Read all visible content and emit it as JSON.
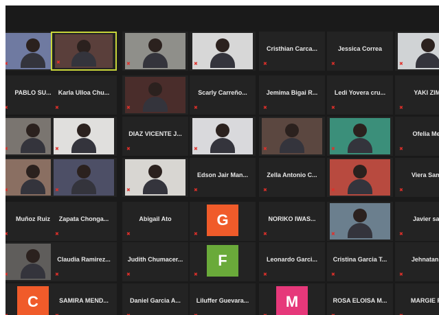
{
  "window": {
    "title": "Zoom gallery view"
  },
  "colors": {
    "speaking_border": "#c9d63a",
    "muted": "#e0302a",
    "grid_bg": "#1a1a1a"
  },
  "participants": [
    {
      "row": 0,
      "col": 0,
      "name": "",
      "type": "video",
      "bg": "#6f7aa1",
      "label": ""
    },
    {
      "row": 0,
      "col": 1,
      "name": "",
      "type": "video",
      "bg": "#5a3f3b",
      "label": "",
      "speaking": true
    },
    {
      "row": 0,
      "col": 2,
      "name": "",
      "type": "video",
      "bg": "#8f8f8a",
      "label": ""
    },
    {
      "row": 0,
      "col": 3,
      "name": "",
      "type": "video",
      "bg": "#d7d7d7",
      "label": ""
    },
    {
      "row": 0,
      "col": 4,
      "name": "Cristhian Carca...",
      "type": "name"
    },
    {
      "row": 0,
      "col": 5,
      "name": "Jessica Correa",
      "type": "name"
    },
    {
      "row": 0,
      "col": 6,
      "name": "",
      "type": "video",
      "bg": "#d0d3d5",
      "label": ""
    },
    {
      "row": 1,
      "col": 0,
      "name": "PABLO SU...",
      "type": "name"
    },
    {
      "row": 1,
      "col": 1,
      "name": "Karla Ulloa Chu...",
      "type": "name"
    },
    {
      "row": 1,
      "col": 2,
      "name": "",
      "type": "video",
      "bg": "#4a2d2b",
      "label": ""
    },
    {
      "row": 1,
      "col": 3,
      "name": "Scarly Carreño...",
      "type": "name"
    },
    {
      "row": 1,
      "col": 4,
      "name": "Jemima Bigai R...",
      "type": "name"
    },
    {
      "row": 1,
      "col": 5,
      "name": "Ledi Yovera cru...",
      "type": "name"
    },
    {
      "row": 1,
      "col": 6,
      "name": "YAKI ZIMI",
      "type": "name"
    },
    {
      "row": 2,
      "col": 0,
      "name": "",
      "type": "video",
      "bg": "#7a7570",
      "label": ""
    },
    {
      "row": 2,
      "col": 1,
      "name": "",
      "type": "video",
      "bg": "#e0dfdd",
      "label": "",
      "speaking": false
    },
    {
      "row": 2,
      "col": 2,
      "name": "DIAZ VICENTE J...",
      "type": "name"
    },
    {
      "row": 2,
      "col": 3,
      "name": "",
      "type": "video",
      "bg": "#d9d9dc",
      "label": ""
    },
    {
      "row": 2,
      "col": 4,
      "name": "",
      "type": "video",
      "bg": "#5b4740",
      "label": ""
    },
    {
      "row": 2,
      "col": 5,
      "name": "",
      "type": "video",
      "bg": "#3b8f7a",
      "label": ""
    },
    {
      "row": 2,
      "col": 6,
      "name": "Ofelia Meli",
      "type": "name"
    },
    {
      "row": 3,
      "col": 0,
      "name": "",
      "type": "video",
      "bg": "#8a6f62",
      "label": ""
    },
    {
      "row": 3,
      "col": 1,
      "name": "",
      "type": "video",
      "bg": "#4d4f66",
      "label": ""
    },
    {
      "row": 3,
      "col": 2,
      "name": "",
      "type": "video",
      "bg": "#d8d6d2",
      "label": ""
    },
    {
      "row": 3,
      "col": 3,
      "name": "Edson Jair Man...",
      "type": "name"
    },
    {
      "row": 3,
      "col": 4,
      "name": "Zella Antonio C...",
      "type": "name"
    },
    {
      "row": 3,
      "col": 5,
      "name": "",
      "type": "video",
      "bg": "#b84a3f",
      "label": ""
    },
    {
      "row": 3,
      "col": 6,
      "name": "Viera Sama",
      "type": "name"
    },
    {
      "row": 4,
      "col": 0,
      "name": "Muñoz Ruiz",
      "type": "name"
    },
    {
      "row": 4,
      "col": 1,
      "name": "Zapata Chonga...",
      "type": "name"
    },
    {
      "row": 4,
      "col": 2,
      "name": "Abigail Ato",
      "type": "name"
    },
    {
      "row": 4,
      "col": 3,
      "name": "",
      "type": "avatar",
      "initial": "G",
      "bg": "#f05b2a"
    },
    {
      "row": 4,
      "col": 4,
      "name": "NORIKO IWAS...",
      "type": "name"
    },
    {
      "row": 4,
      "col": 5,
      "name": "",
      "type": "video",
      "bg": "#6b7f8e",
      "label": ""
    },
    {
      "row": 4,
      "col": 6,
      "name": "Javier san",
      "type": "name"
    },
    {
      "row": 5,
      "col": 0,
      "name": "",
      "type": "video",
      "bg": "#5f5d5b",
      "label": ""
    },
    {
      "row": 5,
      "col": 1,
      "name": "Claudia Ramirez...",
      "type": "name"
    },
    {
      "row": 5,
      "col": 2,
      "name": "Judith Chumacer...",
      "type": "name"
    },
    {
      "row": 5,
      "col": 3,
      "name": "",
      "type": "avatar",
      "initial": "F",
      "bg": "#6aaa3a"
    },
    {
      "row": 5,
      "col": 4,
      "name": "Leonardo Garci...",
      "type": "name"
    },
    {
      "row": 5,
      "col": 5,
      "name": "Cristina Garcia T...",
      "type": "name"
    },
    {
      "row": 5,
      "col": 6,
      "name": "Jehnatan A",
      "type": "name"
    },
    {
      "row": 6,
      "col": 0,
      "name": "",
      "type": "avatar",
      "initial": "C",
      "bg": "#f05b2a"
    },
    {
      "row": 6,
      "col": 1,
      "name": "SAMIRA MEND...",
      "type": "name"
    },
    {
      "row": 6,
      "col": 2,
      "name": "Daniel Garcia A...",
      "type": "name"
    },
    {
      "row": 6,
      "col": 3,
      "name": "Liluffer Guevara...",
      "type": "name"
    },
    {
      "row": 6,
      "col": 4,
      "name": "",
      "type": "avatar",
      "initial": "M",
      "bg": "#e6387a"
    },
    {
      "row": 6,
      "col": 5,
      "name": "ROSA ELOISA M...",
      "type": "name"
    },
    {
      "row": 6,
      "col": 6,
      "name": "MARGIE PA",
      "type": "name"
    }
  ]
}
